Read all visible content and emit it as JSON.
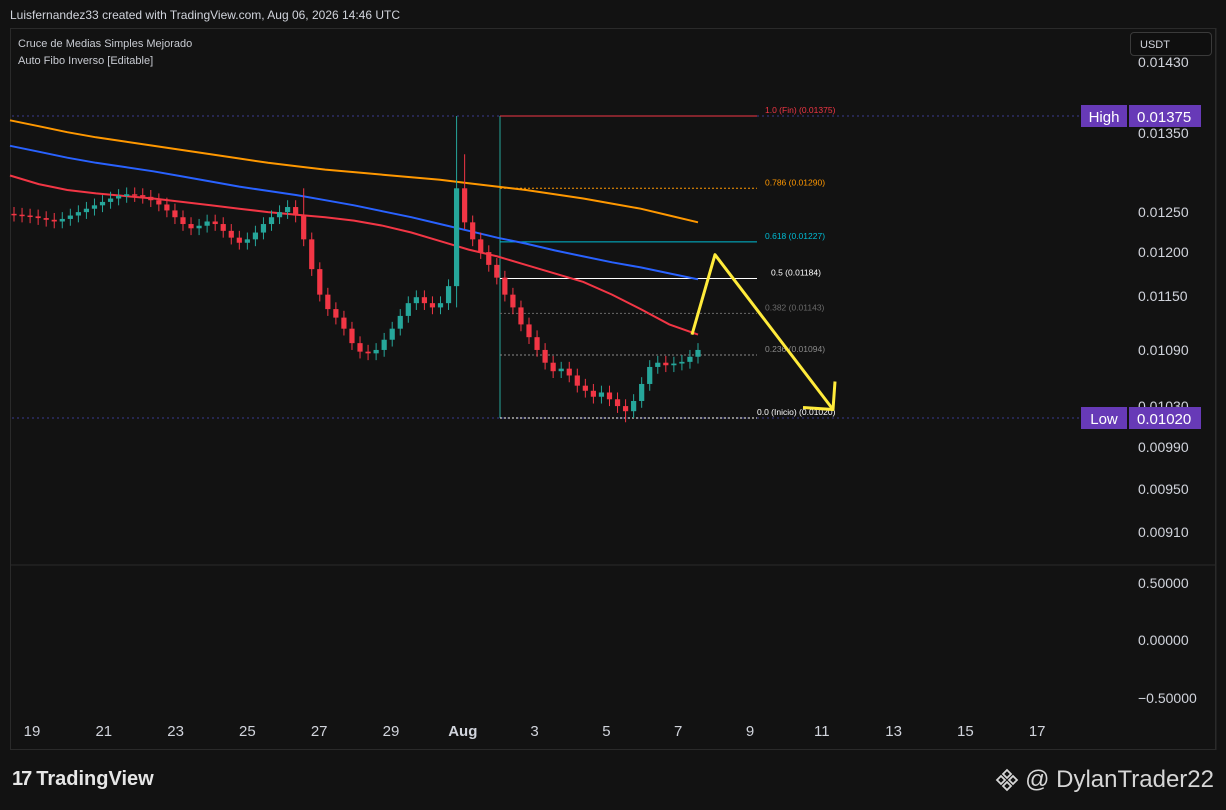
{
  "header": {
    "attribution": "Luisfernandez33 created with TradingView.com, Aug 06, 2026 14:46 UTC"
  },
  "legend": {
    "line1": "Cruce de Medias Simples Mejorado",
    "line2": "Auto Fibo Inverso [Editable]"
  },
  "currency": "USDT",
  "footer": {
    "brand": "TradingView",
    "watermark": "@ DylanTrader22"
  },
  "chart_data": {
    "type": "candlestick",
    "price_axis": {
      "ticks": [
        "0.01430",
        "0.01350",
        "0.01250",
        "0.01200",
        "0.01150",
        "0.01090",
        "0.01030",
        "0.00990",
        "0.00950",
        "0.00910"
      ],
      "ylim": [
        0.0087,
        0.0146
      ]
    },
    "oscillator_axis": {
      "ticks": [
        "0.50000",
        "0.00000",
        "−0.50000"
      ]
    },
    "time_axis": {
      "ticks": [
        "19",
        "21",
        "23",
        "25",
        "27",
        "29",
        "Aug",
        "3",
        "5",
        "7",
        "9",
        "11",
        "13",
        "15",
        "17"
      ]
    },
    "high_marker": {
      "label": "High",
      "value": "0.01375",
      "price": 0.01375
    },
    "low_marker": {
      "label": "Low",
      "value": "0.01020",
      "price": 0.0102
    },
    "fib_levels": [
      {
        "text": "1.0 (Fin) (0.01375)",
        "price": 0.01375,
        "color": "#f23645"
      },
      {
        "text": "0.786 (0.01290)",
        "price": 0.0129,
        "color": "#ff9800"
      },
      {
        "text": "0.618 (0.01227)",
        "price": 0.01227,
        "color": "#00bcd4"
      },
      {
        "text": "0.5 (0.01184)",
        "price": 0.01184,
        "color": "#ffffff"
      },
      {
        "text": "0.382 (0.01143)",
        "price": 0.01143,
        "color": "#6a6a6a"
      },
      {
        "text": "0.236 (0.01094)",
        "price": 0.01094,
        "color": "#8a8a8a"
      },
      {
        "text": "0.0 (Inicio) (0.01020)",
        "price": 0.0102,
        "color": "#ffffff"
      }
    ],
    "candle_closes": [
      0.01259,
      0.01258,
      0.01257,
      0.01255,
      0.01253,
      0.01251,
      0.01254,
      0.01258,
      0.01262,
      0.01266,
      0.0127,
      0.01274,
      0.01278,
      0.01281,
      0.01283,
      0.01282,
      0.0128,
      0.01276,
      0.01271,
      0.01264,
      0.01256,
      0.01248,
      0.01243,
      0.01246,
      0.01251,
      0.01248,
      0.0124,
      0.01232,
      0.01226,
      0.0123,
      0.01238,
      0.01248,
      0.01256,
      0.01262,
      0.01268,
      0.01258,
      0.0123,
      0.01195,
      0.01165,
      0.01148,
      0.01138,
      0.01125,
      0.01108,
      0.01098,
      0.01096,
      0.011,
      0.01112,
      0.01125,
      0.0114,
      0.01155,
      0.01162,
      0.01155,
      0.0115,
      0.01155,
      0.01175,
      0.0129,
      0.0125,
      0.0123,
      0.01215,
      0.012,
      0.01185,
      0.01165,
      0.0115,
      0.0113,
      0.01115,
      0.011,
      0.01085,
      0.01075,
      0.01078,
      0.0107,
      0.01058,
      0.01052,
      0.01045,
      0.0105,
      0.01042,
      0.01034,
      0.01028,
      0.0104,
      0.0106,
      0.0108,
      0.01085,
      0.01082,
      0.01084,
      0.01086,
      0.01092,
      0.011
    ],
    "ma_orange": [
      0.0137,
      0.01363,
      0.01356,
      0.0135,
      0.01345,
      0.0134,
      0.01335,
      0.0133,
      0.01325,
      0.0132,
      0.01316,
      0.01312,
      0.01309,
      0.01306,
      0.01303,
      0.013,
      0.01296,
      0.01292,
      0.01288,
      0.01283,
      0.01278,
      0.01272,
      0.01266,
      0.01258,
      0.0125
    ],
    "ma_blue": [
      0.0134,
      0.01333,
      0.01326,
      0.0132,
      0.01315,
      0.0131,
      0.01304,
      0.01298,
      0.01292,
      0.01287,
      0.01282,
      0.01276,
      0.0127,
      0.01263,
      0.01256,
      0.01248,
      0.0124,
      0.01232,
      0.01225,
      0.01217,
      0.0121,
      0.01203,
      0.01197,
      0.0119,
      0.01183
    ],
    "ma_red": [
      0.01305,
      0.01295,
      0.01288,
      0.01284,
      0.01281,
      0.01278,
      0.01274,
      0.0127,
      0.01266,
      0.01262,
      0.01259,
      0.01256,
      0.01252,
      0.01246,
      0.01238,
      0.01228,
      0.01218,
      0.0121,
      0.012,
      0.0119,
      0.0118,
      0.01165,
      0.01148,
      0.0113,
      0.01118
    ],
    "projection_arrow": {
      "color": "#ffeb3b",
      "path": [
        0.01118,
        0.01212,
        0.0103
      ]
    },
    "colors": {
      "up": "#26a69a",
      "down": "#f23645",
      "marker": "#673ab7"
    }
  }
}
